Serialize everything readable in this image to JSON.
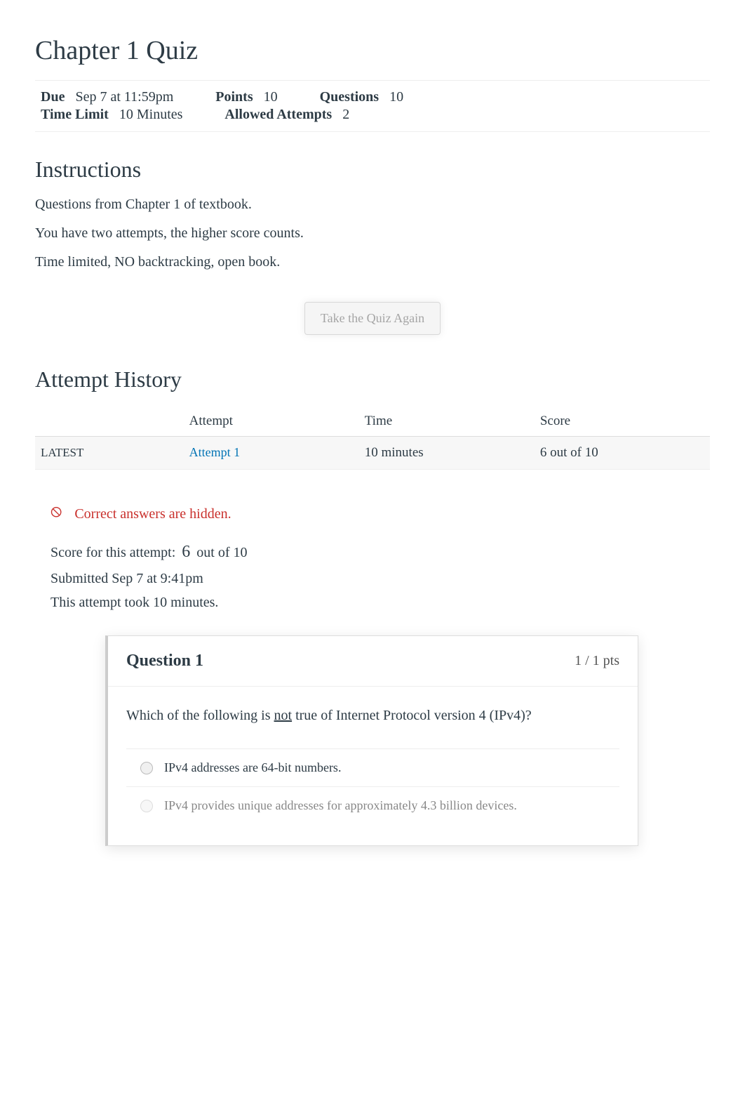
{
  "title": "Chapter 1 Quiz",
  "meta": {
    "due_label": "Due",
    "due_value": "Sep 7 at 11:59pm",
    "points_label": "Points",
    "points_value": "10",
    "questions_label": "Questions",
    "questions_value": "10",
    "time_limit_label": "Time Limit",
    "time_limit_value": "10 Minutes",
    "allowed_label": "Allowed Attempts",
    "allowed_value": "2"
  },
  "instructions": {
    "heading": "Instructions",
    "p1": "Questions from Chapter 1 of textbook.",
    "p2": "You have two attempts, the higher score counts.",
    "p3": "Time limited, NO backtracking, open book."
  },
  "take_button": "Take the Quiz Again",
  "history": {
    "heading": "Attempt History",
    "col_blank": "",
    "col_attempt": "Attempt",
    "col_time": "Time",
    "col_score": "Score",
    "row": {
      "latest": "LATEST",
      "attempt": "Attempt 1",
      "time": "10 minutes",
      "score": "6 out of 10"
    }
  },
  "hidden_msg": "Correct answers are hidden.",
  "attempt_summary": {
    "score_prefix": "Score for this attempt:",
    "score_num": "6",
    "score_suffix": "out of 10",
    "submitted": "Submitted Sep 7 at 9:41pm",
    "took": "This attempt took 10 minutes."
  },
  "question": {
    "label": "Question 1",
    "pts": "1 / 1 pts",
    "text_pre": "Which of the following is ",
    "text_underline": "not",
    "text_post": " true of Internet Protocol version 4 (IPv4)?",
    "answers": [
      {
        "text": "IPv4 addresses are 64-bit numbers.",
        "dim": false
      },
      {
        "text": "IPv4 provides unique addresses for approximately 4.3 billion devices.",
        "dim": true
      }
    ]
  }
}
